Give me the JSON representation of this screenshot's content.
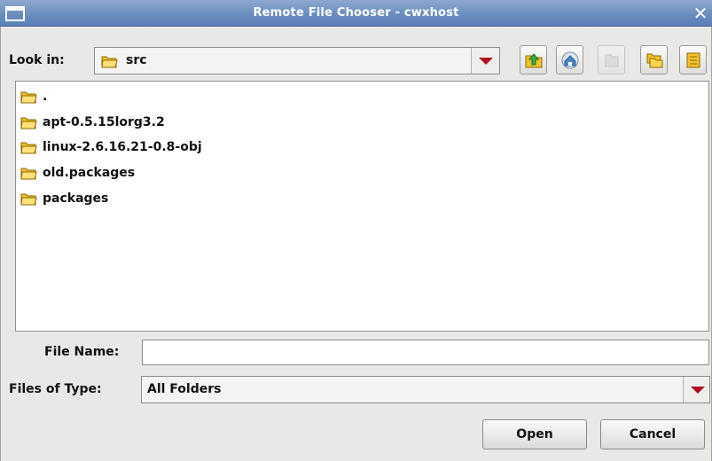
{
  "window": {
    "title": "Remote File Chooser - cwxhost",
    "close_glyph": "✕"
  },
  "lookin": {
    "label": "Look in:",
    "value": "src",
    "icon": "folder-icon"
  },
  "toolbar": {
    "buttons": [
      {
        "name": "up-one-level-button",
        "icon": "folder-up-icon",
        "enabled": true
      },
      {
        "name": "home-button",
        "icon": "home-icon",
        "enabled": true
      },
      {
        "name": "new-folder-button",
        "icon": "new-folder-icon",
        "enabled": false
      },
      {
        "name": "list-view-button",
        "icon": "list-view-icon",
        "enabled": true
      },
      {
        "name": "details-view-button",
        "icon": "details-view-icon",
        "enabled": true
      }
    ]
  },
  "files": [
    {
      "name": "."
    },
    {
      "name": "apt-0.5.15lorg3.2"
    },
    {
      "name": "linux-2.6.16.21-0.8-obj"
    },
    {
      "name": "old.packages"
    },
    {
      "name": "packages"
    }
  ],
  "file_name": {
    "label": "File Name:",
    "value": ""
  },
  "file_type": {
    "label": "Files of Type:",
    "value": "All Folders"
  },
  "buttons": {
    "open": "Open",
    "cancel": "Cancel"
  },
  "colors": {
    "titlebar": "#6b8ec0",
    "arrow": "#b01020",
    "folder": "#f2c12e"
  }
}
